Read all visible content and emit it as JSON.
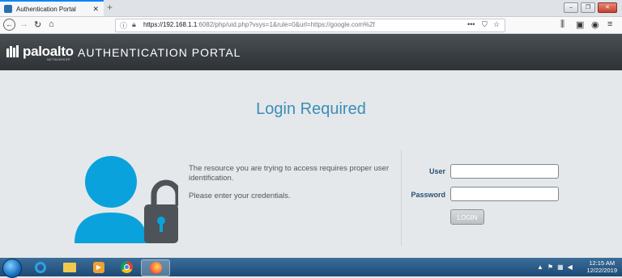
{
  "browser": {
    "tab_title": "Authentication Portal",
    "tab_close": "✕",
    "new_tab": "+",
    "url_host": "https://192.168.1.1",
    "url_rest": ":6082/php/uid.php?vsys=1&rule=0&url=https://google.com%2f",
    "url_more": "•••"
  },
  "header": {
    "logo_text": "paloalto",
    "logo_sub": "NETWORKS®",
    "portal_title": "AUTHENTICATION PORTAL"
  },
  "main": {
    "title": "Login Required",
    "message_line": "The resource you are trying to access requires proper user identification.",
    "message_credentials": "Please enter your credentials."
  },
  "form": {
    "user_label": "User",
    "password_label": "Password",
    "user_value": "",
    "password_value": "",
    "login_button": "LOGIN"
  },
  "taskbar": {
    "time": "12:15 AM",
    "date": "12/22/2019"
  },
  "colors": {
    "accent_title": "#3d8db8",
    "avatar_blue": "#0aa2dc",
    "lock_gray": "#4d5358",
    "label_blue": "#2a4f74"
  }
}
